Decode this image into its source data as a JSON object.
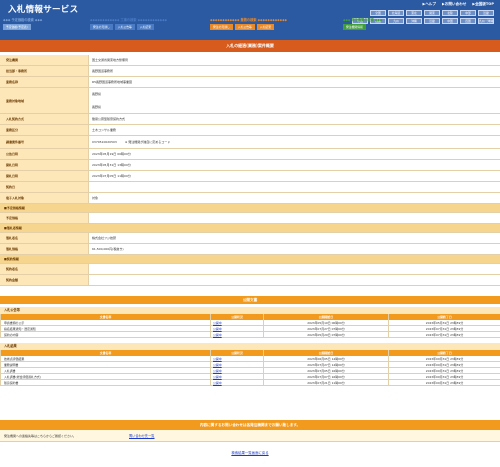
{
  "header": {
    "title": "入札情報サービス",
    "links": [
      "▶ヘルプ",
      "▶お問い合わせ",
      "▶全国版TOP"
    ],
    "prefs1": [
      "全国",
      "北海道",
      "東北",
      "関東",
      "北陸",
      "中部",
      "近畿"
    ],
    "prefs2": [
      "中国",
      "四国",
      "九州",
      "沖縄",
      "近畿",
      "中国",
      "四国",
      "九州・沖縄"
    ],
    "groups": [
      {
        "head": "◆◆◆ 予定価格の検索 ◆◆◆",
        "tabs": [
          "予定価格(予定表)"
        ],
        "color": "#7aa2d8"
      },
      {
        "head": "◆◆◆◆◆◆◆◆◆◆◆◆ 工事の検索 ◆◆◆◆◆◆◆◆◆◆◆◆",
        "tabs": [
          "発注の見通し",
          "入札公告等",
          "入札結果"
        ],
        "color": "#4a7bc4"
      },
      {
        "head": "◆◆◆◆◆◆◆◆◆◆◆◆ 業務の検索 ◆◆◆◆◆◆◆◆◆◆◆◆",
        "tabs": [
          "発注の見通し",
          "入札公告等",
          "入札結果"
        ],
        "color": "#e88a2a"
      },
      {
        "head": "◆◆◆ 発注機関の検索 ◆◆◆",
        "tabs": [
          "発注機関情報"
        ],
        "color": "#3f9d3a"
      }
    ]
  },
  "band": "入札の経過(業務)案件概要",
  "details": [
    {
      "label": "発注機関",
      "value": "国土交通省関東地方整備局"
    },
    {
      "label": "担当部・事務所",
      "value": "長野国道事務所"
    },
    {
      "label": "業務名称",
      "value": "R5長野国道事務所地域事業図"
    },
    {
      "label": "業務対象地域",
      "value": "長野県"
    },
    {
      "label": "入札契約方式",
      "value": "簡易公募型随意契約方式"
    },
    {
      "label": "業務区分",
      "value": "土木コンサル業務"
    },
    {
      "label": "調達案件番号",
      "value": "0370510020503"
    },
    {
      "label": "公告日時",
      "value": "2023年05月19日 00時00分"
    },
    {
      "label": "開札日時",
      "value": "2023年05月31日 13時00分"
    },
    {
      "label": "開札日時",
      "value": "2023年07月05日 11時00分"
    },
    {
      "label": "契約日",
      "value": ""
    },
    {
      "label": "電子入札対象",
      "value": "対象"
    }
  ],
  "region_extra": "長野県",
  "code_note": "※ 発注機関が独自に定めるコード",
  "sec_estimate": "■予定価格情報",
  "estimate_label": "予定価格",
  "sec_winner": "■落札者情報",
  "winner_label": "落札者名",
  "winner": "株式会社フジ技研",
  "amount_label": "落札価格",
  "amount": "61,500,000円(税抜き)",
  "sec_contract": "■契約情報",
  "contract_rows": [
    "契約者名",
    "契約金額"
  ],
  "docs": {
    "bar": "公開文書",
    "koukoku_title": "入札公告等",
    "koukoku_headers": [
      "文書名称",
      "公開状況",
      "公開開始日",
      "公開終了日"
    ],
    "koukoku_rows": [
      [
        "申請書類の公示",
        "公開中",
        "2023年05月19日 00時00分",
        "2023年05月31日 23時59分"
      ],
      [
        "指名結果通知・選定通知",
        "公開中",
        "2023年07月27日 07時00分",
        "2023年07月31日 23時59分"
      ],
      [
        "契約の内容",
        "公開中",
        "2023年05月29日 07時00分",
        "2023年07月31日 23時59分"
      ]
    ],
    "kekka_title": "入札結果",
    "kekka_headers": [
      "文書名称",
      "公開状況",
      "公開開始日",
      "公開終了日"
    ],
    "kekka_rows": [
      [
        "技術点評価結果",
        "公開中",
        "2023年06月05日 14時00分",
        "2023年09月31日 23時59分"
      ],
      [
        "業務説明書",
        "公開中",
        "2023年07月27日 14時00分",
        "2023年09月31日 23時59分"
      ],
      [
        "入札調書",
        "公開中",
        "2023年07月05日 16時00分",
        "2023年09月31日 23時59分"
      ],
      [
        "入札調書(総合評価落札方式)",
        "公開中",
        "2023年07月07日 16時00分",
        "2023年09月31日 23時59分"
      ],
      [
        "随意契約書",
        "公開中",
        "2023年07月21日 11時00分",
        "2023年09月31日 23時59分"
      ]
    ]
  },
  "footer": {
    "bar": "内容に関するお問い合わせは各発注機関までお願い致します。",
    "org": "発注機関への連絡先等はこちらからご確認ください。",
    "link": "問い合わせ先一覧"
  },
  "back": "検索結果一覧画面に戻る"
}
